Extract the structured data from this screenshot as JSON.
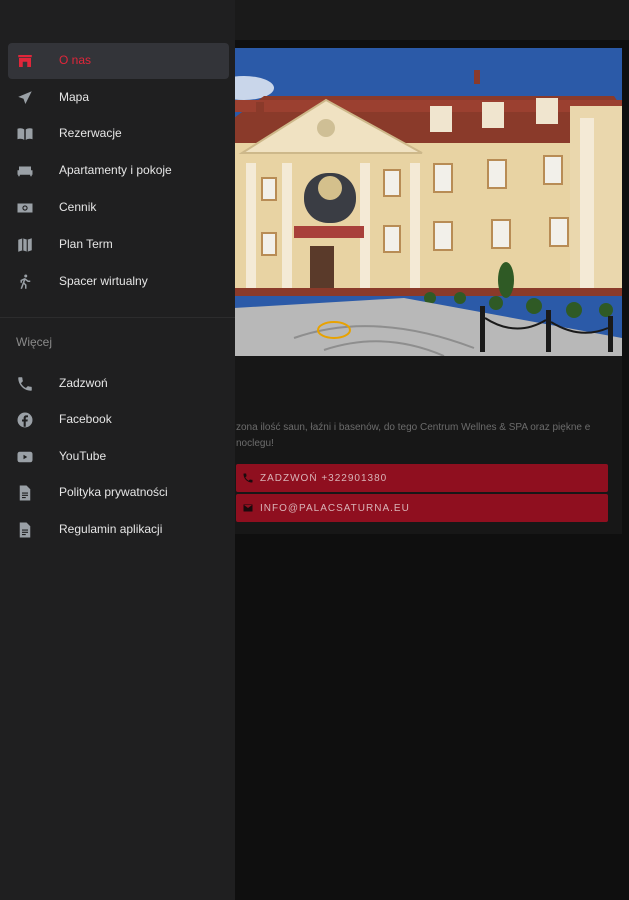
{
  "drawer": {
    "main_items": [
      {
        "label": "O nas",
        "icon": "home-icon",
        "active": true
      },
      {
        "label": "Mapa",
        "icon": "navigation-arrow-icon"
      },
      {
        "label": "Rezerwacje",
        "icon": "book-icon"
      },
      {
        "label": "Apartamenty i pokoje",
        "icon": "bed-icon"
      },
      {
        "label": "Cennik",
        "icon": "money-icon"
      },
      {
        "label": "Plan Term",
        "icon": "map-icon"
      },
      {
        "label": "Spacer wirtualny",
        "icon": "walking-icon"
      }
    ],
    "section_title": "Więcej",
    "more_items": [
      {
        "label": "Zadzwoń",
        "icon": "phone-icon"
      },
      {
        "label": "Facebook",
        "icon": "facebook-icon"
      },
      {
        "label": "YouTube",
        "icon": "youtube-icon"
      },
      {
        "label": "Polityka prywatności",
        "icon": "document-icon"
      },
      {
        "label": "Regulamin aplikacji",
        "icon": "document-icon"
      }
    ]
  },
  "content": {
    "description": "zona ilość saun, łaźni i basenów, do tego Centrum Wellnes & SPA oraz piękne e noclegu!",
    "call_button": "ZADZWOŃ +322901380",
    "email_button": "INFO@PALACSATURNA.EU"
  },
  "colors": {
    "accent": "#e0263a",
    "cta_background": "#8f0f1f",
    "drawer_background": "#1f1f20"
  }
}
